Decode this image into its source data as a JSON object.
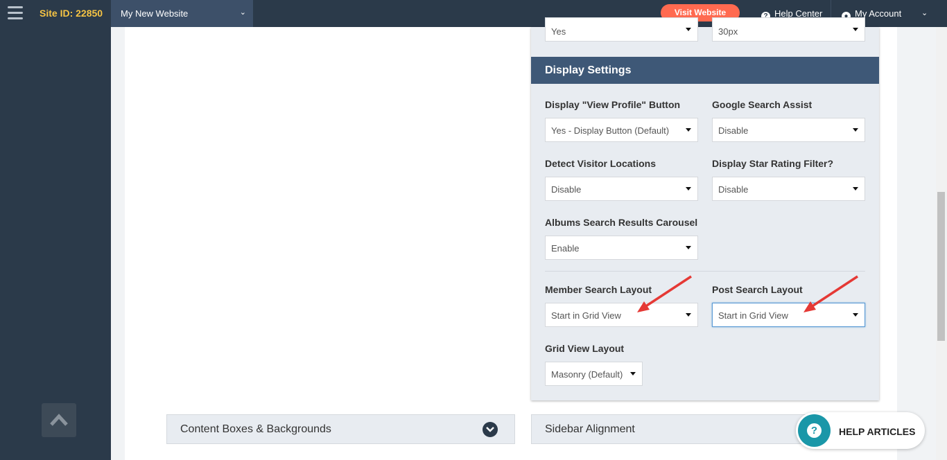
{
  "topbar": {
    "site_id": "Site ID: 22850",
    "site_name": "My New Website",
    "visit_label": "Visit Website",
    "help_center": "Help Center",
    "my_account": "My Account",
    "accent_color": "#ff6a50",
    "bg_color": "#2b3a4a"
  },
  "top_partial": {
    "left_value": "Yes",
    "right_value": "30px"
  },
  "display_settings": {
    "header": "Display Settings",
    "fields": {
      "view_profile": {
        "label": "Display \"View Profile\" Button",
        "value": "Yes - Display Button (Default)"
      },
      "google_assist": {
        "label": "Google Search Assist",
        "value": "Disable"
      },
      "detect_locations": {
        "label": "Detect Visitor Locations",
        "value": "Disable"
      },
      "star_rating": {
        "label": "Display Star Rating Filter?",
        "value": "Disable"
      },
      "albums_carousel": {
        "label": "Albums Search Results Carousel",
        "value": "Enable"
      },
      "member_layout": {
        "label": "Member Search Layout",
        "value": "Start in Grid View"
      },
      "post_layout": {
        "label": "Post Search Layout",
        "value": "Start in Grid View"
      },
      "grid_layout": {
        "label": "Grid View Layout",
        "value": "Masonry (Default)"
      }
    }
  },
  "accordions": {
    "content_boxes": "Content Boxes & Backgrounds",
    "sidebar_alignment": "Sidebar Alignment"
  },
  "help_widget": {
    "label": "HELP ARTICLES",
    "icon_glyph": "?",
    "color": "#1a97a8"
  },
  "icons": {
    "help_glyph": "?",
    "account_glyph": "●"
  }
}
